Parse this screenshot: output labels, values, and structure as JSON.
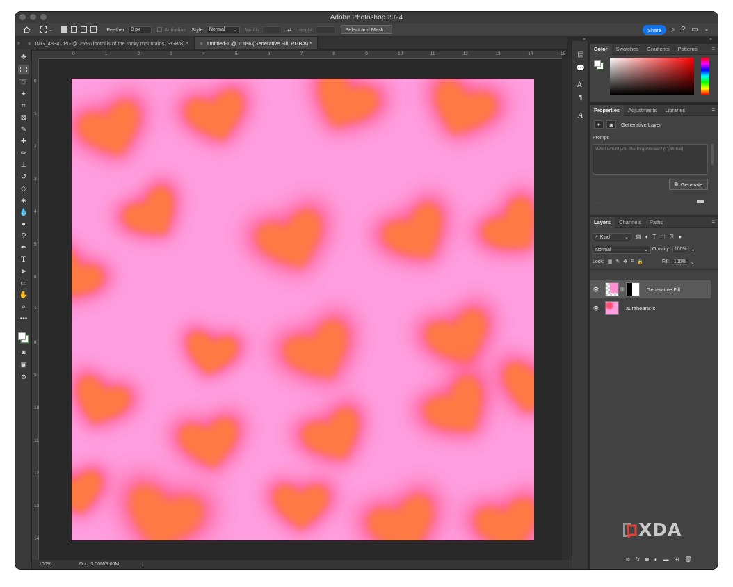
{
  "window": {
    "title": "Adobe Photoshop 2024"
  },
  "options_bar": {
    "feather_label": "Feather:",
    "feather_value": "0 px",
    "antialias_label": "Anti-alias",
    "style_label": "Style:",
    "style_value": "Normal",
    "width_label": "Width:",
    "height_label": "Height:",
    "select_mask_label": "Select and Mask...",
    "share_label": "Share"
  },
  "tabs": [
    {
      "label": "IMG_4834.JPG @ 25% (foothills of the rocky mountains, RGB/8) *",
      "active": false
    },
    {
      "label": "Untitled-1 @ 100% (Generative Fill, RGB/8) *",
      "active": true
    }
  ],
  "ruler": {
    "top_ticks": [
      "0",
      "1",
      "2",
      "3",
      "4",
      "5",
      "6",
      "7",
      "8",
      "9",
      "10",
      "11",
      "12",
      "13",
      "14",
      "15"
    ],
    "left_ticks": [
      "0",
      "1",
      "2",
      "3",
      "4",
      "5",
      "6",
      "7",
      "8",
      "9",
      "10",
      "11",
      "12",
      "13",
      "14"
    ]
  },
  "status": {
    "zoom": "100%",
    "doc": "Doc: 3.00M/9.00M",
    "arrow": "›"
  },
  "color_panel": {
    "tabs": [
      "Color",
      "Swatches",
      "Gradients",
      "Patterns"
    ],
    "active": "Color"
  },
  "properties_panel": {
    "tabs": [
      "Properties",
      "Adjustments",
      "Libraries"
    ],
    "active": "Properties",
    "layer_type": "Generative Layer",
    "prompt_label": "Prompt:",
    "prompt_placeholder": "What would you like to generate? (Optional)",
    "generate_label": "Generate"
  },
  "layers_panel": {
    "tabs": [
      "Layers",
      "Channels",
      "Paths"
    ],
    "active": "Layers",
    "filter_kind": "Kind",
    "blend_mode": "Normal",
    "opacity_label": "Opacity:",
    "opacity_value": "100%",
    "lock_label": "Lock:",
    "fill_label": "Fill:",
    "fill_value": "100%",
    "layers": [
      {
        "name": "Generative Fill",
        "selected": true,
        "has_mask": true
      },
      {
        "name": "aurahearts-x",
        "selected": false,
        "has_mask": false
      }
    ]
  },
  "watermark": {
    "text": "XDA"
  },
  "colors": {
    "canvas_bg": "#ff9fe0",
    "heart_fill": "#ff7a45",
    "heart_glow": "#ff3f74",
    "accent": "#1473e6"
  }
}
